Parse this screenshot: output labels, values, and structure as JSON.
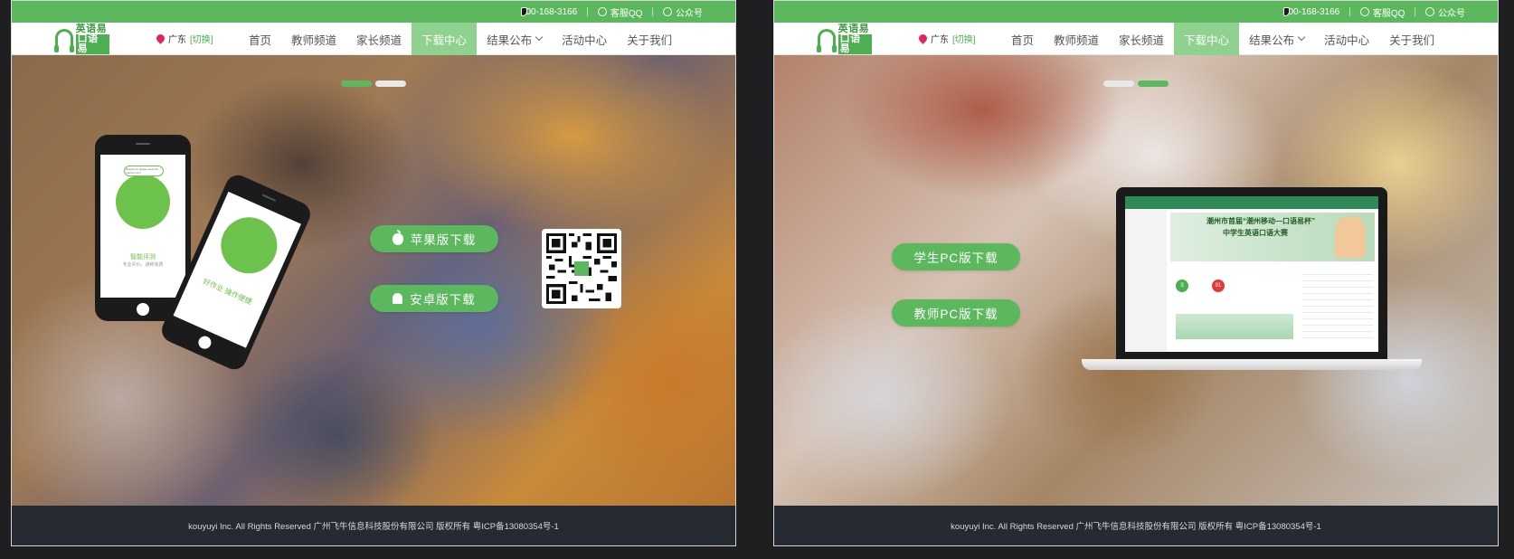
{
  "panels": [
    {
      "topbar": {
        "phone": "400-168-3166",
        "qq": "客服QQ",
        "wechat": "公众号",
        "separator": "|"
      },
      "logo": {
        "line1": "英语易",
        "line2": "口语易"
      },
      "region": {
        "name": "广东",
        "switch": "[切换]"
      },
      "nav": [
        {
          "label": "首页"
        },
        {
          "label": "教师频道"
        },
        {
          "label": "家长频道"
        },
        {
          "label": "下载中心",
          "active": true
        },
        {
          "label": "结果公布",
          "dropdown": true
        },
        {
          "label": "活动中心"
        },
        {
          "label": "关于我们"
        }
      ],
      "carousel": {
        "active_slide": 1,
        "slide_count": 2
      },
      "buttons": {
        "ios": "苹果版下载",
        "android": "安卓版下载"
      },
      "phone_screen": {
        "bubble": "Would you please send the mail for me?",
        "caption": "智能评测",
        "subcaption": "专业评价、通称收费",
        "second_caption": "好作业 操作便捷"
      },
      "footer": "kouyuyi Inc. All Rights Reserved 广州飞牛信息科技股份有限公司 版权所有   粤ICP备13080354号-1"
    },
    {
      "topbar": {
        "phone": "400-168-3166",
        "qq": "客服QQ",
        "wechat": "公众号",
        "separator": "|"
      },
      "logo": {
        "line1": "英语易",
        "line2": "口语易"
      },
      "region": {
        "name": "广东",
        "switch": "[切换]"
      },
      "nav": [
        {
          "label": "首页"
        },
        {
          "label": "教师频道"
        },
        {
          "label": "家长频道"
        },
        {
          "label": "下载中心",
          "active": true
        },
        {
          "label": "结果公布",
          "dropdown": true
        },
        {
          "label": "活动中心"
        },
        {
          "label": "关于我们"
        }
      ],
      "carousel": {
        "active_slide": 2,
        "slide_count": 2
      },
      "buttons": {
        "student_pc": "学生PC版下载",
        "teacher_pc": "教师PC版下载"
      },
      "laptop_screen": {
        "banner_title": "潮州市首届“潮州移动—口语易杯”",
        "banner_subtitle": "中学生英语口语大赛",
        "score_a": "3",
        "score_b": "91"
      },
      "footer": "kouyuyi Inc. All Rights Reserved 广州飞牛信息科技股份有限公司 版权所有   粤ICP备13080354号-1"
    }
  ],
  "colors": {
    "brand_green": "#5cb85c",
    "nav_active": "#8fd18f",
    "footer_bg": "#262b33",
    "page_bg": "#1f1f21"
  }
}
